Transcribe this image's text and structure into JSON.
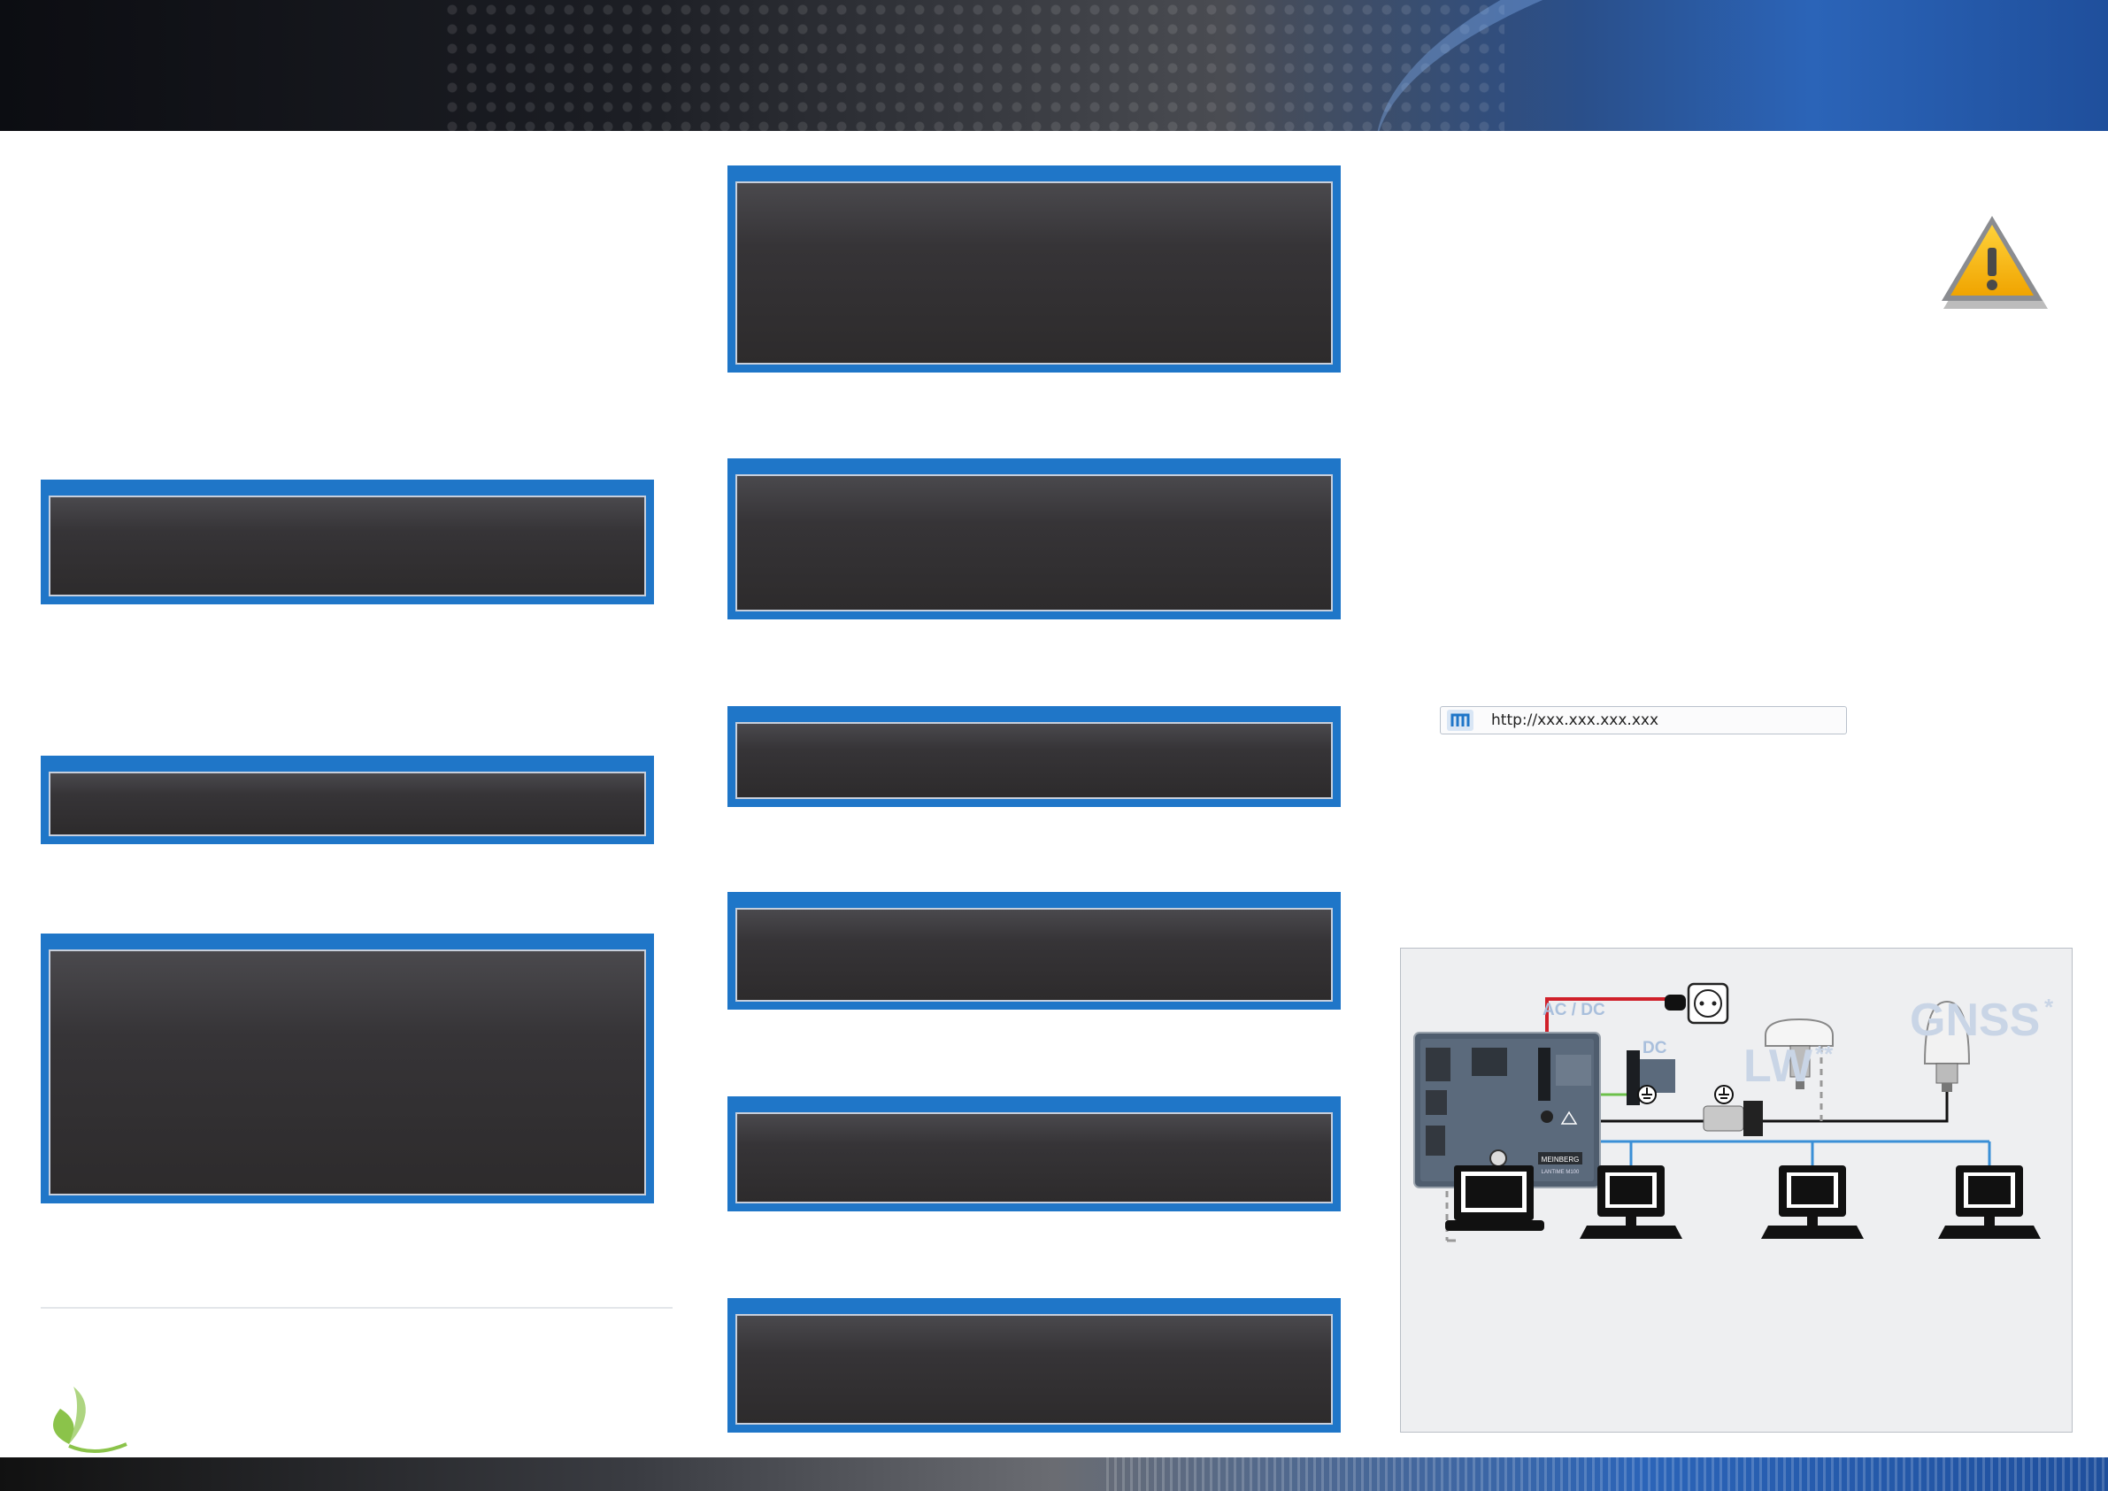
{
  "browser_bar": {
    "url": "http://xxx.xxx.xxx.xxx",
    "logo_icon": "meinberg-m-icon"
  },
  "diagram": {
    "labels": {
      "power": "AC / DC",
      "dc": "DC",
      "lw": "LW",
      "lw_mark": "**",
      "gnss": "GNSS",
      "gnss_mark": "*",
      "brand": "MEINBERG",
      "model": "LANTIME M100"
    },
    "colors": {
      "power_cable": "#d0202a",
      "network_cable": "#3a8fd6",
      "ground_cable": "#6cc04a",
      "label_blue": "#a9bfdc",
      "panel_blue": "#1f76c8"
    }
  },
  "icons": [
    "warning-icon",
    "leaf-icon",
    "power-socket-icon",
    "ground-icon",
    "laptop-icon",
    "desktop-computer-icon"
  ]
}
